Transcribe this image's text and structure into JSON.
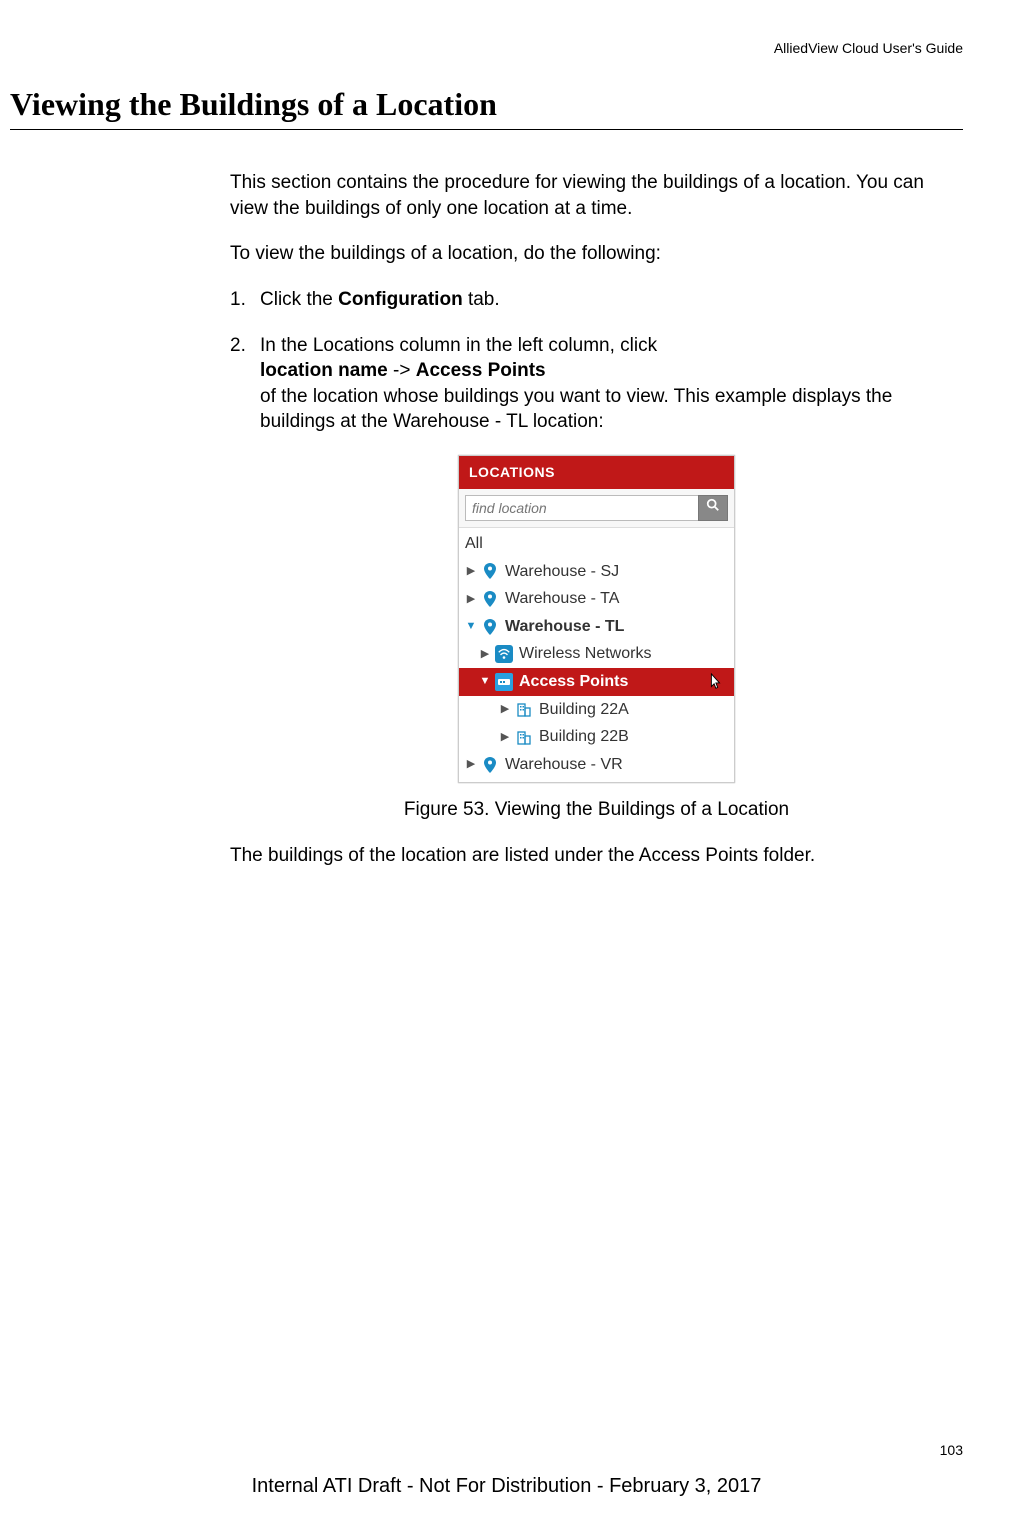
{
  "header": {
    "guide_title": "AlliedView Cloud User's Guide"
  },
  "section": {
    "title": "Viewing the Buildings of a Location"
  },
  "content": {
    "intro": "This section contains the procedure for viewing the buildings of a location. You can view the buildings of only one location at a time.",
    "lead": "To view the buildings of a location, do the following:",
    "step1_num": "1.",
    "step1_a": "Click the ",
    "step1_b": "Configuration",
    "step1_c": " tab.",
    "step2_num": "2.",
    "step2_a": "In the Locations column in the left column, click",
    "step2_b": "location name",
    "step2_c": " -> ",
    "step2_d": "Access Points",
    "step2_e": "of the location whose buildings you want to view. This example displays the buildings at the Warehouse - TL location:",
    "after_fig": "The buildings of the location are listed under the Access Points folder."
  },
  "panel": {
    "header": "LOCATIONS",
    "search_placeholder": "find location",
    "all": "All",
    "items": {
      "sj": "Warehouse - SJ",
      "ta": "Warehouse - TA",
      "tl": "Warehouse - TL",
      "wireless": "Wireless Networks",
      "access_points": "Access Points",
      "b22a": "Building 22A",
      "b22b": "Building 22B",
      "vr": "Warehouse - VR"
    }
  },
  "figure": {
    "caption": "Figure 53. Viewing the Buildings of a Location"
  },
  "footer": {
    "page_number": "103",
    "draft_notice": "Internal ATI Draft - Not For Distribution - February 3, 2017"
  }
}
